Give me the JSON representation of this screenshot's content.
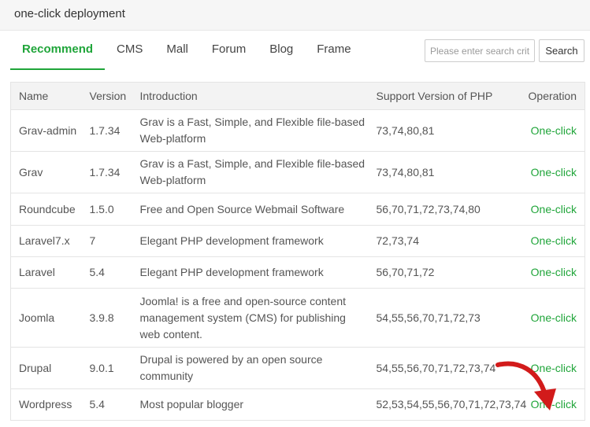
{
  "window": {
    "title": "one-click deployment"
  },
  "tabs": [
    {
      "label": "Recommend",
      "active": true
    },
    {
      "label": "CMS",
      "active": false
    },
    {
      "label": "Mall",
      "active": false
    },
    {
      "label": "Forum",
      "active": false
    },
    {
      "label": "Blog",
      "active": false
    },
    {
      "label": "Frame",
      "active": false
    }
  ],
  "search": {
    "placeholder": "Please enter search criteria",
    "value": "",
    "button_label": "Search"
  },
  "table": {
    "headers": {
      "name": "Name",
      "version": "Version",
      "introduction": "Introduction",
      "php": "Support Version of PHP",
      "operation": "Operation"
    },
    "rows": [
      {
        "name": "Grav-admin",
        "version": "1.7.34",
        "introduction": "Grav is a Fast, Simple, and Flexible file-based Web-platform",
        "php": "73,74,80,81",
        "operation": "One-click"
      },
      {
        "name": "Grav",
        "version": "1.7.34",
        "introduction": "Grav is a Fast, Simple, and Flexible file-based Web-platform",
        "php": "73,74,80,81",
        "operation": "One-click"
      },
      {
        "name": "Roundcube",
        "version": "1.5.0",
        "introduction": "Free and Open Source Webmail Software",
        "php": "56,70,71,72,73,74,80",
        "operation": "One-click"
      },
      {
        "name": "Laravel7.x",
        "version": "7",
        "introduction": "Elegant PHP development framework",
        "php": "72,73,74",
        "operation": "One-click"
      },
      {
        "name": "Laravel",
        "version": "5.4",
        "introduction": "Elegant PHP development framework",
        "php": "56,70,71,72",
        "operation": "One-click"
      },
      {
        "name": "Joomla",
        "version": "3.9.8",
        "introduction": "Joomla! is a free and open-source content management system (CMS) for publishing web content.",
        "php": "54,55,56,70,71,72,73",
        "operation": "One-click"
      },
      {
        "name": "Drupal",
        "version": "9.0.1",
        "introduction": "Drupal is powered by an open source community",
        "php": "54,55,56,70,71,72,73,74",
        "operation": "One-click"
      },
      {
        "name": "Wordpress",
        "version": "5.4",
        "introduction": "Most popular blogger",
        "php": "52,53,54,55,56,70,71,72,73,74",
        "operation": "One-click"
      }
    ]
  },
  "colors": {
    "accent": "#20a53a",
    "annotation_arrow": "#d21b1b"
  },
  "annotation": {
    "icon": "red-curved-arrow-icon",
    "points_to": "Wordpress One-click"
  }
}
